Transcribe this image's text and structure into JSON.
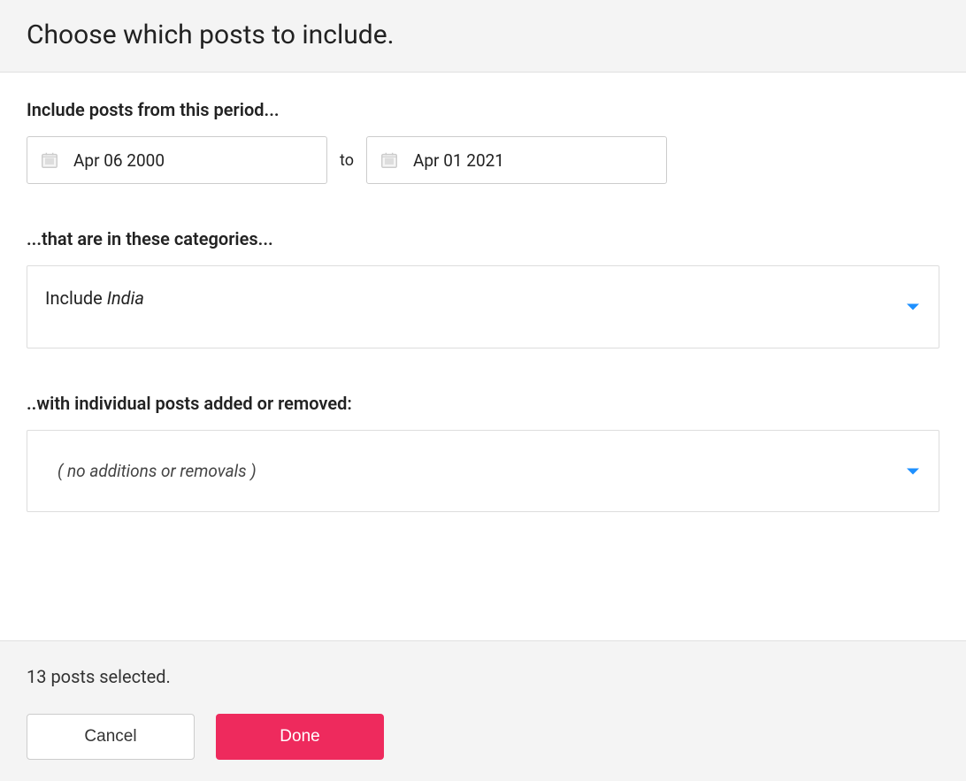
{
  "header": {
    "title": "Choose which posts to include."
  },
  "period": {
    "label": "Include posts from this period...",
    "from_date": "Apr 06 2000",
    "to_label": "to",
    "to_date": "Apr 01 2021"
  },
  "categories": {
    "label": "...that are in these categories...",
    "prefix": "Include ",
    "value": "India"
  },
  "individual": {
    "label": "..with individual posts added or removed:",
    "value": "( no additions or removals )"
  },
  "footer": {
    "status": "13 posts selected.",
    "cancel": "Cancel",
    "done": "Done"
  }
}
